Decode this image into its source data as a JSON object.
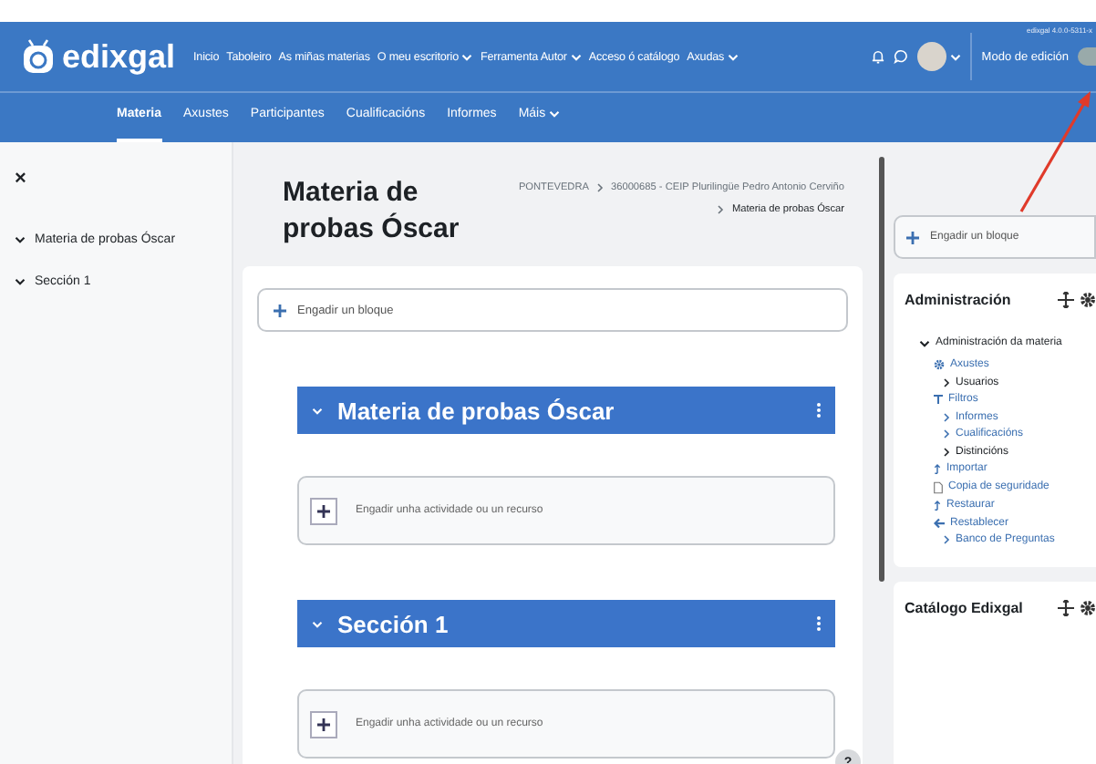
{
  "header": {
    "logo": "edixgal",
    "nav": [
      {
        "label": "Inicio",
        "dropdown": false
      },
      {
        "label": "Taboleiro",
        "dropdown": false
      },
      {
        "label": "As miñas materias",
        "dropdown": false
      },
      {
        "label": "O meu escritorio",
        "dropdown": true
      },
      {
        "label": "Ferramenta Autor",
        "dropdown": true
      },
      {
        "label": "Acceso ó catálogo",
        "dropdown": false
      },
      {
        "label": "Axudas",
        "dropdown": true
      }
    ],
    "version": "edixgal 4.0.0-5311-x",
    "edit_mode": {
      "label": "Modo de edición",
      "on": false
    }
  },
  "course_nav": [
    {
      "label": "Materia",
      "selected": true,
      "dropdown": false
    },
    {
      "label": "Axustes",
      "selected": false,
      "dropdown": false
    },
    {
      "label": "Participantes",
      "selected": false,
      "dropdown": false
    },
    {
      "label": "Cualificacións",
      "selected": false,
      "dropdown": false
    },
    {
      "label": "Informes",
      "selected": false,
      "dropdown": false
    },
    {
      "label": "Máis",
      "selected": false,
      "dropdown": true
    }
  ],
  "drawer": {
    "close": "×",
    "items": [
      {
        "label": "Materia de probas Óscar",
        "expanded": true
      },
      {
        "label": "Sección 1",
        "expanded": true
      }
    ]
  },
  "page": {
    "title": "Materia de probas Óscar",
    "breadcrumb": [
      "PONTEVEDRA",
      "36000685 - CEIP Plurilingüe Pedro Antonio Cerviño",
      "Materia de probas Óscar"
    ],
    "add_block": "Engadir un bloque",
    "sections": [
      {
        "title": "Materia de probas Óscar",
        "expanded": true,
        "add_activity": "Engadir unha actividade ou un recurso"
      },
      {
        "title": "Sección 1",
        "expanded": true,
        "add_activity": "Engadir unha actividade ou un recurso"
      }
    ],
    "help": "?"
  },
  "right": {
    "add_block": "Engadir un bloque",
    "admin": {
      "title": "Administración",
      "tree": [
        {
          "label": "Administración da materia",
          "kind": "folder",
          "link": false,
          "children": [
            {
              "label": "Axustes",
              "kind": "gear",
              "link": true
            },
            {
              "label": "Usuarios",
              "kind": "chevron",
              "link": false
            },
            {
              "label": "Filtros",
              "kind": "filter",
              "link": true
            },
            {
              "label": "Informes",
              "kind": "chevron",
              "link": true
            },
            {
              "label": "Cualificacións",
              "kind": "chevron",
              "link": true
            },
            {
              "label": "Distincións",
              "kind": "chevron",
              "link": false
            },
            {
              "label": "Importar",
              "kind": "upload",
              "link": true
            },
            {
              "label": "Copia de seguridade",
              "kind": "file",
              "link": true
            },
            {
              "label": "Restaurar",
              "kind": "upload",
              "link": true
            },
            {
              "label": "Restablecer",
              "kind": "back",
              "link": true
            },
            {
              "label": "Banco de Preguntas",
              "kind": "chevron",
              "link": true
            }
          ]
        }
      ]
    },
    "catalog": {
      "title": "Catálogo Edixgal"
    }
  }
}
